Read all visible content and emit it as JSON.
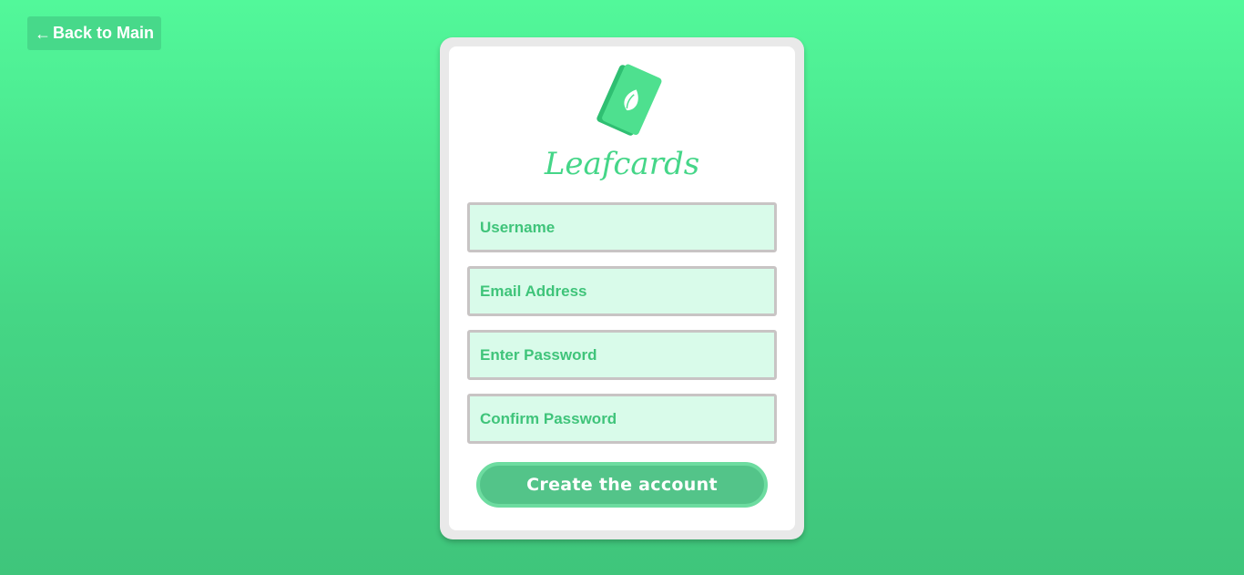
{
  "nav": {
    "back_arrow": "←",
    "back_label": "Back to Main"
  },
  "brand": {
    "logo_text": "Leafcards",
    "accent": "#3fc47a",
    "logo_green": "#4ee08f",
    "logo_dark_green": "#2fbf72"
  },
  "form": {
    "username_placeholder": "Username",
    "email_placeholder": "Email Address",
    "password_placeholder": "Enter Password",
    "confirm_placeholder": "Confirm Password",
    "submit_label": "Create the account"
  },
  "colors": {
    "background_top": "#52f89a",
    "background_bottom": "#3fc57b",
    "field_bg": "#d9fbea",
    "field_border": "#c8c4c4",
    "button_bg": "#53c489"
  }
}
